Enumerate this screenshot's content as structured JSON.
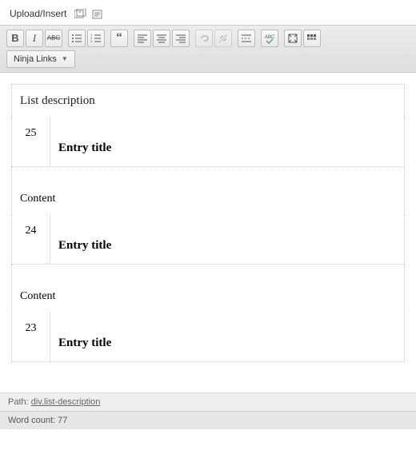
{
  "upload": {
    "label": "Upload/Insert"
  },
  "toolbar": {
    "dropdown_label": "Ninja Links"
  },
  "editor": {
    "list_description": "List description",
    "entries": [
      {
        "num": "25",
        "title": "Entry title",
        "content_label": "Content"
      },
      {
        "num": "24",
        "title": "Entry title",
        "content_label": "Content"
      },
      {
        "num": "23",
        "title": "Entry title",
        "content_label": ""
      }
    ]
  },
  "path": {
    "label": "Path: ",
    "value": "div.list-description"
  },
  "wordcount": {
    "label": "Word count: ",
    "value": "77"
  }
}
